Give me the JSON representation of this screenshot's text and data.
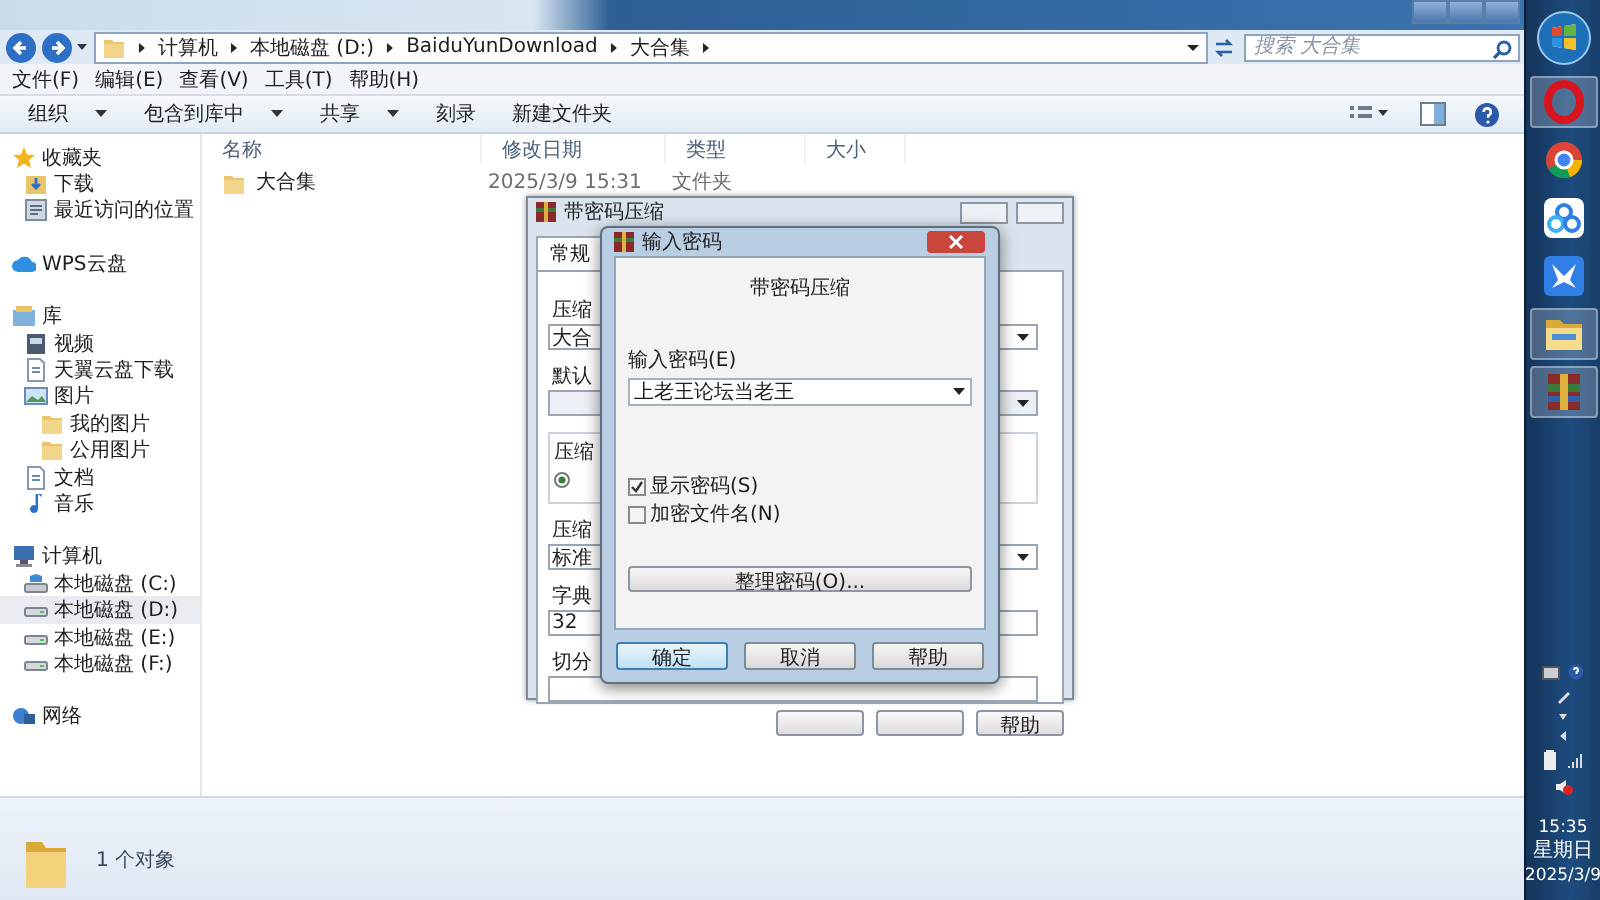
{
  "explorer": {
    "address": {
      "segments": [
        "计算机",
        "本地磁盘 (D:)",
        "BaiduYunDownload",
        "大合集"
      ]
    },
    "search": {
      "placeholder": "搜索 大合集"
    },
    "menu": [
      "文件(F)",
      "编辑(E)",
      "查看(V)",
      "工具(T)",
      "帮助(H)"
    ],
    "toolbar": [
      {
        "label": "组织",
        "dropdown": true
      },
      {
        "label": "包含到库中",
        "dropdown": true
      },
      {
        "label": "共享",
        "dropdown": true
      },
      {
        "label": "刻录",
        "dropdown": false
      },
      {
        "label": "新建文件夹",
        "dropdown": false
      }
    ],
    "sidebar": [
      {
        "label": "收藏夹",
        "kind": "favorites",
        "selected": false,
        "children": [
          {
            "label": "下载",
            "kind": "downloads",
            "selected": false
          },
          {
            "label": "最近访问的位置",
            "kind": "recent",
            "selected": false
          }
        ]
      },
      {
        "label": "WPS云盘",
        "kind": "cloud",
        "selected": false
      },
      {
        "label": "库",
        "kind": "library",
        "selected": false,
        "children": [
          {
            "label": "视频",
            "kind": "video",
            "selected": false
          },
          {
            "label": "天翼云盘下载",
            "kind": "document",
            "selected": false
          },
          {
            "label": "图片",
            "kind": "pictures",
            "selected": false,
            "children": [
              {
                "label": "我的图片",
                "kind": "folder",
                "selected": false
              },
              {
                "label": "公用图片",
                "kind": "folder",
                "selected": false
              }
            ]
          },
          {
            "label": "文档",
            "kind": "document",
            "selected": false
          },
          {
            "label": "音乐",
            "kind": "music",
            "selected": false
          }
        ]
      },
      {
        "label": "计算机",
        "kind": "computer",
        "selected": false,
        "children": [
          {
            "label": "本地磁盘 (C:)",
            "kind": "system-drive",
            "selected": false
          },
          {
            "label": "本地磁盘 (D:)",
            "kind": "drive",
            "selected": true
          },
          {
            "label": "本地磁盘 (E:)",
            "kind": "drive",
            "selected": false
          },
          {
            "label": "本地磁盘 (F:)",
            "kind": "drive",
            "selected": false
          }
        ]
      },
      {
        "label": "网络",
        "kind": "network",
        "selected": false
      }
    ],
    "table": {
      "columns": [
        "名称",
        "修改日期",
        "类型",
        "大小"
      ],
      "rows": [
        {
          "name": "大合集",
          "modified": "2025/3/9 15:31",
          "type": "文件夹"
        }
      ]
    },
    "status_bar": "1 个对象"
  },
  "archive_dialog": {
    "title": "带密码压缩",
    "tabs": [
      {
        "label": "常规",
        "selected": true
      }
    ],
    "fields": [
      {
        "kind": "label",
        "text": "压缩"
      },
      {
        "kind": "combo",
        "value": "大合"
      },
      {
        "kind": "label",
        "text": "默认"
      },
      {
        "kind": "combo"
      },
      {
        "kind": "group",
        "text": "压缩",
        "selected": true
      },
      {
        "kind": "label",
        "text": "压缩"
      },
      {
        "kind": "combo",
        "value": "标准"
      },
      {
        "kind": "label",
        "text": "字典"
      },
      {
        "kind": "field",
        "value": "32"
      },
      {
        "kind": "label",
        "text": "切分"
      },
      {
        "kind": "field"
      }
    ],
    "buttons": [
      "帮助"
    ]
  },
  "password_dialog": {
    "title": "输入密码",
    "heading": "带密码压缩",
    "password_label": "输入密码(E)",
    "password": "上老王论坛当老王",
    "options": [
      {
        "label": "显示密码(S)",
        "checked": true
      },
      {
        "label": "加密文件名(N)",
        "checked": false
      }
    ],
    "manage_button": "整理密码(O)...",
    "buttons": [
      {
        "label": "确定",
        "default": true
      },
      {
        "label": "取消",
        "default": false
      },
      {
        "label": "帮助",
        "default": false
      }
    ]
  },
  "taskbar": {
    "apps": [
      {
        "kind": "ring",
        "active": true
      },
      {
        "kind": "circle",
        "active": false
      },
      {
        "kind": "cloud",
        "active": false
      },
      {
        "kind": "bird",
        "active": false
      },
      {
        "kind": "folder",
        "active": true
      },
      {
        "kind": "archive",
        "active": true
      }
    ],
    "clock": {
      "time": "15:35",
      "day": "星期日",
      "date": "2025/3/9"
    }
  }
}
